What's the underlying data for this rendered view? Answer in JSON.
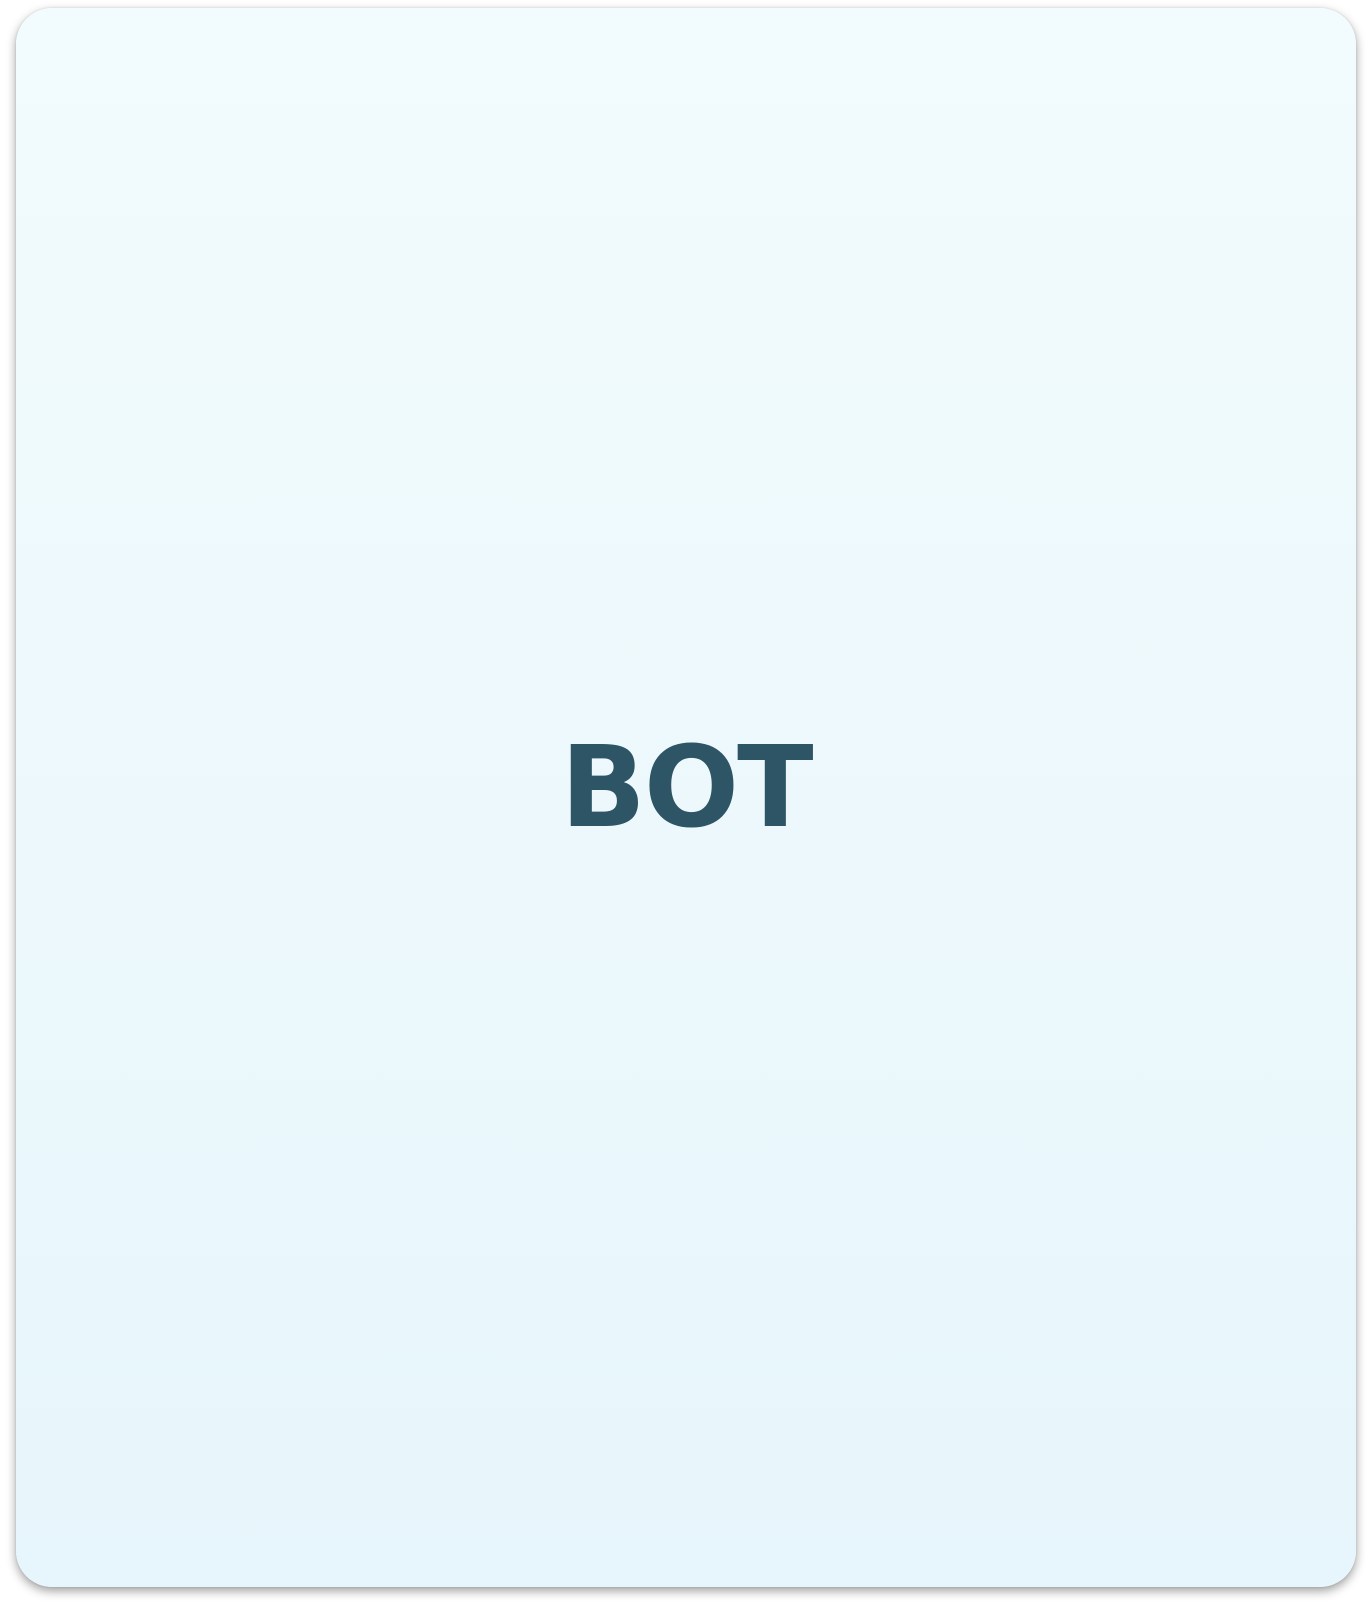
{
  "card": {
    "label": "BOT"
  },
  "colors": {
    "background_top": "#f2fbfd",
    "background_bottom": "#e7f6fc",
    "label_text": "#2e5565"
  }
}
